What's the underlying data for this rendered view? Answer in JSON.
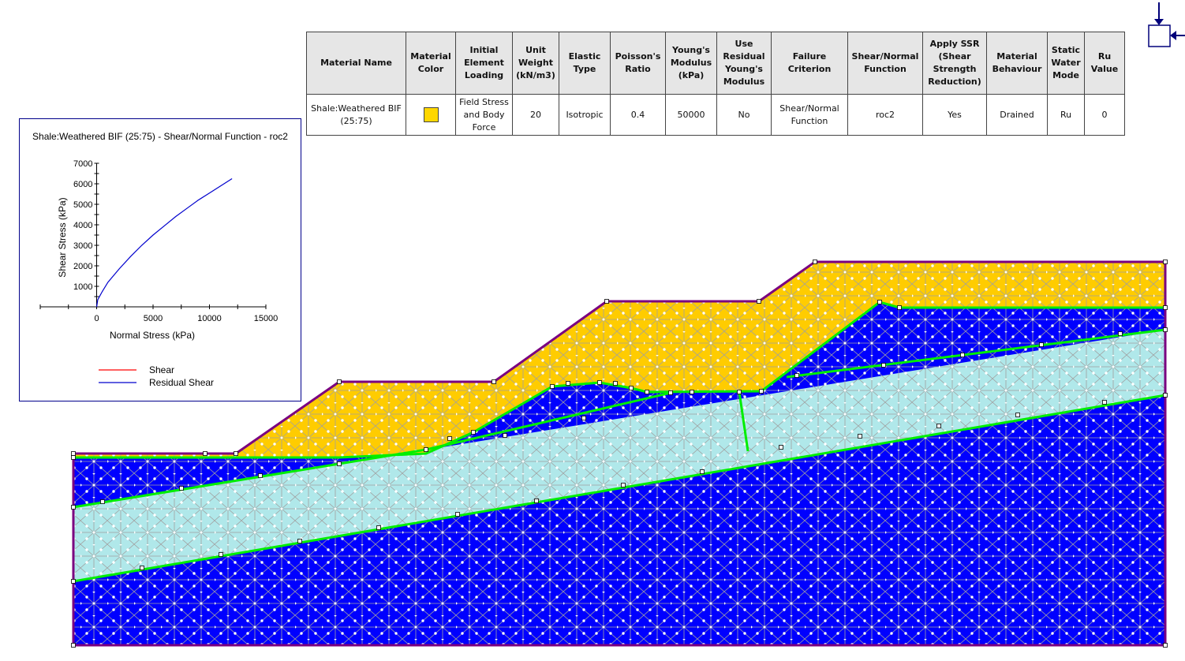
{
  "material_table": {
    "headers": [
      "Material Name",
      "Material Color",
      "Initial Element Loading",
      "Unit Weight (kN/m3)",
      "Elastic Type",
      "Poisson's Ratio",
      "Young's Modulus (kPa)",
      "Use Residual Young's Modulus",
      "Failure Criterion",
      "Shear/Normal Function",
      "Apply SSR (Shear Strength Reduction)",
      "Material Behaviour",
      "Static Water Mode",
      "Ru Value"
    ],
    "row": {
      "material_name": "Shale:Weathered BIF (25:75)",
      "material_color": "#ffd700",
      "initial_element_loading": "Field Stress and Body Force",
      "unit_weight": "20",
      "elastic_type": "Isotropic",
      "poissons_ratio": "0.4",
      "youngs_modulus": "50000",
      "use_residual_youngs_modulus": "No",
      "failure_criterion": "Shear/Normal Function",
      "shear_normal_function": "roc2",
      "apply_ssr": "Yes",
      "material_behaviour": "Drained",
      "static_water_mode": "Ru",
      "ru_value": "0"
    }
  },
  "chart_data": {
    "type": "line",
    "title": "Shale:Weathered BIF (25:75) - Shear/Normal Function - roc2",
    "xlabel": "Normal Stress (kPa)",
    "ylabel": "Shear Stress (kPa)",
    "xlim": [
      -5000,
      15000
    ],
    "ylim": [
      0,
      7000
    ],
    "x_ticks": [
      0,
      5000,
      10000,
      15000
    ],
    "y_ticks": [
      1000,
      2000,
      3000,
      4000,
      5000,
      6000,
      7000
    ],
    "grid": false,
    "legend_position": "bottom",
    "series": [
      {
        "name": "Shear",
        "color": "#ff0000",
        "x": [],
        "y": []
      },
      {
        "name": "Residual Shear",
        "color": "#0000cd",
        "x": [
          0,
          100,
          500,
          1000,
          2000,
          3000,
          4000,
          5000,
          6000,
          7000,
          8000,
          9000,
          10000,
          11000,
          12000
        ],
        "y": [
          0,
          350,
          750,
          1200,
          1850,
          2450,
          3000,
          3500,
          3950,
          4400,
          4800,
          5200,
          5550,
          5900,
          6250
        ]
      }
    ]
  },
  "model": {
    "colors": {
      "weathered_bif": "#ffcc00",
      "dark_layer": "#0000ff",
      "light_layer": "#b0e8ea",
      "boundary": "#7a0080",
      "material_boundary": "#00ee00",
      "mesh": "#a0a0a0"
    }
  },
  "icons": {
    "loads": "field-stress-loads-icon"
  }
}
